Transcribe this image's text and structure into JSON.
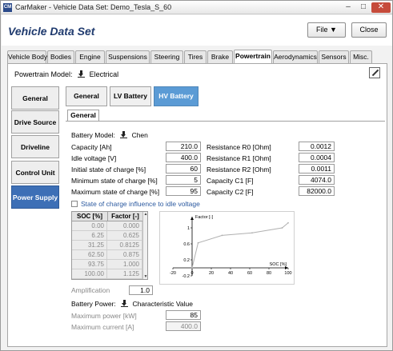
{
  "window": {
    "app_icon": "CM",
    "title": "CarMaker - Vehicle Data Set: Demo_Tesla_S_60",
    "controls": [
      "–",
      "□",
      "✕"
    ]
  },
  "header": {
    "title": "Vehicle Data Set",
    "file_button": "File ▼",
    "close_button": "Close"
  },
  "tabs": [
    "Vehicle Body",
    "Bodies",
    "Engine",
    "Suspensions",
    "Steering",
    "Tires",
    "Brake",
    "Powertrain",
    "Aerodynamics",
    "Sensors",
    "Misc."
  ],
  "powertrain_model": {
    "label": "Powertrain Model:",
    "value": "Electrical"
  },
  "sidebar": [
    "General",
    "Drive Source",
    "Driveline",
    "Control Unit",
    "Power Supply"
  ],
  "subtabs": [
    "General",
    "LV Battery",
    "HV Battery"
  ],
  "inner_tab": "General",
  "battery_model": {
    "label": "Battery Model:",
    "value": "Chen"
  },
  "fields_left": [
    {
      "label": "Capacity [Ah]",
      "value": "210.0"
    },
    {
      "label": "Idle voltage [V]",
      "value": "400.0"
    },
    {
      "label": "Initial state of charge [%]",
      "value": "60"
    },
    {
      "label": "Minimum state of charge [%]",
      "value": "5"
    },
    {
      "label": "Maximum state of charge [%]",
      "value": "95"
    }
  ],
  "fields_right": [
    {
      "label": "Resistance R0 [Ohm]",
      "value": "0.0012"
    },
    {
      "label": "Resistance R1 [Ohm]",
      "value": "0.0004"
    },
    {
      "label": "Resistance R2 [Ohm]",
      "value": "0.0011"
    },
    {
      "label": "Capacity C1 [F]",
      "value": "4074.0"
    },
    {
      "label": "Capacity C2 [F]",
      "value": "82000.0"
    }
  ],
  "soc_influence_checkbox": {
    "label": "State of charge influence to idle voltage",
    "checked": false
  },
  "soc_table": {
    "headers": [
      "SOC [%]",
      "Factor [-]"
    ],
    "rows": [
      [
        "0.00",
        "0.000"
      ],
      [
        "6.25",
        "0.625"
      ],
      [
        "31.25",
        "0.8125"
      ],
      [
        "62.50",
        "0.875"
      ],
      [
        "93.75",
        "1.000"
      ],
      [
        "100.00",
        "1.125"
      ]
    ]
  },
  "amplification": {
    "label": "Amplification",
    "value": "1.0"
  },
  "battery_power": {
    "label": "Battery Power:",
    "value": "Characteristic Value"
  },
  "max_power": {
    "label": "Maximum power [kW]",
    "value": "85"
  },
  "max_current": {
    "label": "Maximum current [A]",
    "value": "400.0"
  },
  "chart_data": {
    "type": "line",
    "title": "",
    "xlabel": "SOC [%]",
    "ylabel": "Factor [-]",
    "xlim": [
      -20,
      100
    ],
    "ylim": [
      -0.2,
      1.2
    ],
    "xticks": [
      "-20",
      "0",
      "20",
      "40",
      "60",
      "80",
      "100"
    ],
    "yticks": [
      "-0.2",
      "0.2",
      "0.6",
      "1"
    ],
    "x": [
      0.0,
      6.25,
      31.25,
      62.5,
      93.75,
      100.0
    ],
    "y": [
      0.0,
      0.625,
      0.8125,
      0.875,
      1.0,
      1.125
    ],
    "line_color": "#b0b0b0"
  }
}
